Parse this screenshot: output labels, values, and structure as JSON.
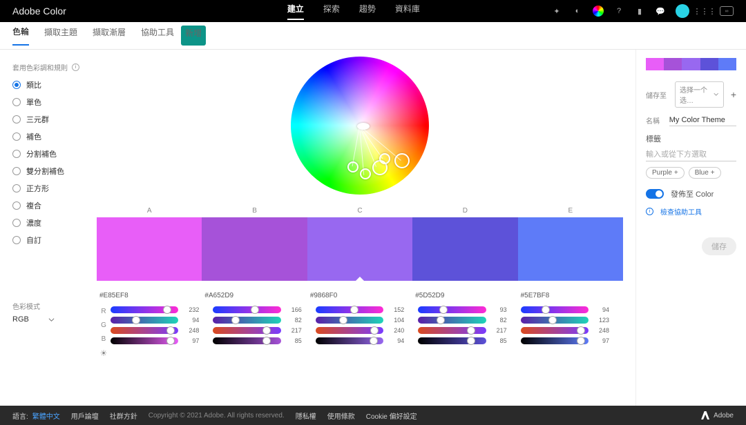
{
  "brand": "Adobe Color",
  "topnav": {
    "create": "建立",
    "explore": "探索",
    "trends": "趨勢",
    "libraries": "資料庫"
  },
  "subnav": {
    "wheel": "色輪",
    "extract_theme": "擷取主題",
    "extract_gradient": "擷取漸層",
    "accessibility": "協助工具",
    "new_badge": "新增"
  },
  "rule_title": "套用色彩調和規則",
  "rules": [
    "類比",
    "單色",
    "三元群",
    "補色",
    "分割補色",
    "雙分割補色",
    "正方形",
    "複合",
    "濃度",
    "自訂"
  ],
  "mode_label": "色彩模式",
  "mode_value": "RGB",
  "columns": [
    "A",
    "B",
    "C",
    "D",
    "E"
  ],
  "swatches": [
    {
      "hex": "#E85EF8",
      "r": 232,
      "g": 94,
      "b": 248,
      "bright": 97
    },
    {
      "hex": "#A652D9",
      "r": 166,
      "g": 82,
      "b": 217,
      "bright": 85
    },
    {
      "hex": "#9868F0",
      "r": 152,
      "g": 104,
      "b": 240,
      "bright": 94
    },
    {
      "hex": "#5D52D9",
      "r": 93,
      "g": 82,
      "b": 217,
      "bright": 85
    },
    {
      "hex": "#5E7BF8",
      "r": 94,
      "g": 123,
      "b": 248,
      "bright": 97
    }
  ],
  "slider_labels": {
    "r": "R",
    "g": "G",
    "b": "B"
  },
  "panel": {
    "save_to_label": "儲存至",
    "save_to_value": "选择一个选…",
    "name_label": "名稱",
    "name_value": "My Color Theme",
    "tags_label": "標籤",
    "tags_placeholder": "輸入或從下方選取",
    "tag_purple": "Purple",
    "tag_blue": "Blue",
    "publish_label": "發佈至 Color",
    "check_a11y": "檢查協助工具",
    "save_btn": "儲存"
  },
  "footer": {
    "lang_label": "語言:",
    "lang_value": "繁體中文",
    "forum": "用戶論壇",
    "community": "社群方針",
    "copyright": "Copyright © 2021 Adobe. All rights reserved.",
    "privacy": "隱私權",
    "terms": "使用條款",
    "cookie": "Cookie 偏好設定",
    "adobe": "Adobe"
  }
}
